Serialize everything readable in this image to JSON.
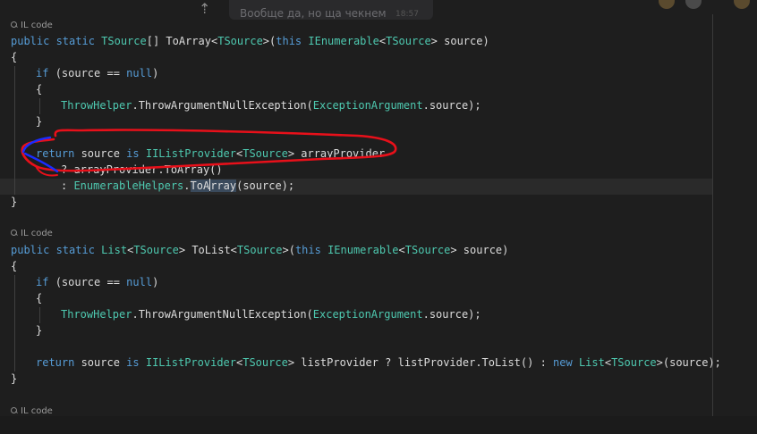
{
  "chat": {
    "message": "Вообще да, но ща чекнем",
    "time": "18:57"
  },
  "codelens": [
    "IL code",
    "IL code",
    "IL code"
  ],
  "code": {
    "m1_sig": [
      {
        "t": "public static ",
        "c": "kw"
      },
      {
        "t": "TSource",
        "c": "ty"
      },
      {
        "t": "[] ToArray<",
        "c": "pl"
      },
      {
        "t": "TSource",
        "c": "ty"
      },
      {
        "t": ">(",
        "c": "pl"
      },
      {
        "t": "this ",
        "c": "kw"
      },
      {
        "t": "IEnumerable",
        "c": "ty"
      },
      {
        "t": "<",
        "c": "pl"
      },
      {
        "t": "TSource",
        "c": "ty"
      },
      {
        "t": "> source)",
        "c": "pl"
      }
    ],
    "open_brace": "{",
    "close_brace": "}",
    "if_line": [
      {
        "t": "if ",
        "c": "kw"
      },
      {
        "t": "(source == ",
        "c": "pl"
      },
      {
        "t": "null",
        "c": "kw"
      },
      {
        "t": ")",
        "c": "pl"
      }
    ],
    "throw_line": [
      {
        "t": "ThrowHelper",
        "c": "ty"
      },
      {
        "t": ".ThrowArgumentNullException(",
        "c": "pl"
      },
      {
        "t": "ExceptionArgument",
        "c": "ty"
      },
      {
        "t": ".source);",
        "c": "pl"
      }
    ],
    "m1_return": [
      {
        "t": "return ",
        "c": "kw"
      },
      {
        "t": "source ",
        "c": "pl"
      },
      {
        "t": "is ",
        "c": "kw"
      },
      {
        "t": "IIListProvider",
        "c": "ty"
      },
      {
        "t": "<",
        "c": "pl"
      },
      {
        "t": "TSource",
        "c": "ty"
      },
      {
        "t": "> arrayProvider",
        "c": "pl"
      }
    ],
    "m1_ternary1": [
      {
        "t": "? arrayProvider.ToArray()",
        "c": "pl"
      }
    ],
    "m1_ternary2_pre": ": ",
    "m1_ternary2_type": "EnumerableHelpers",
    "m1_ternary2_dot": ".",
    "m1_ternary2_sel1": "ToA",
    "m1_ternary2_sel2": "rray",
    "m1_ternary2_post": "(source);",
    "m2_sig": [
      {
        "t": "public static ",
        "c": "kw"
      },
      {
        "t": "List",
        "c": "ty"
      },
      {
        "t": "<",
        "c": "pl"
      },
      {
        "t": "TSource",
        "c": "ty"
      },
      {
        "t": "> ToList<",
        "c": "pl"
      },
      {
        "t": "TSource",
        "c": "ty"
      },
      {
        "t": ">(",
        "c": "pl"
      },
      {
        "t": "this ",
        "c": "kw"
      },
      {
        "t": "IEnumerable",
        "c": "ty"
      },
      {
        "t": "<",
        "c": "pl"
      },
      {
        "t": "TSource",
        "c": "ty"
      },
      {
        "t": "> source)",
        "c": "pl"
      }
    ],
    "m2_return": [
      {
        "t": "return ",
        "c": "kw"
      },
      {
        "t": "source ",
        "c": "pl"
      },
      {
        "t": "is ",
        "c": "kw"
      },
      {
        "t": "IIListProvider",
        "c": "ty"
      },
      {
        "t": "<",
        "c": "pl"
      },
      {
        "t": "TSource",
        "c": "ty"
      },
      {
        "t": "> listProvider ? listProvider.ToList() : ",
        "c": "pl"
      },
      {
        "t": "new ",
        "c": "kw"
      },
      {
        "t": "List",
        "c": "ty"
      },
      {
        "t": "<",
        "c": "pl"
      },
      {
        "t": "TSource",
        "c": "ty"
      },
      {
        "t": ">(source);",
        "c": "pl"
      }
    ]
  },
  "colors": {
    "background": "#1e1e1e",
    "keyword": "#569cd6",
    "type": "#4ec9b0",
    "text": "#dcdcdc",
    "ink_red": "#e8101a",
    "ink_blue": "#1a2cff"
  }
}
